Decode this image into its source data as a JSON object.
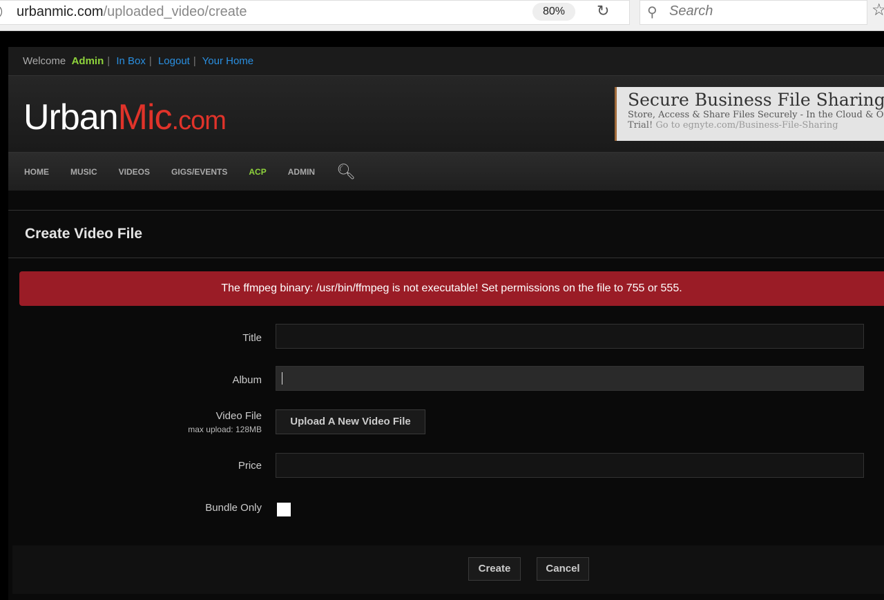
{
  "browser": {
    "url_domain": "urbanmic.com",
    "url_path": "/uploaded_video/create",
    "zoom": "80%",
    "search_placeholder": "Search"
  },
  "topbar": {
    "welcome": "Welcome",
    "user": "Admin",
    "links": [
      "In Box",
      "Logout",
      "Your Home"
    ]
  },
  "logo": {
    "part1": "Urban",
    "part2": "Mic",
    "part3": ".com"
  },
  "ad": {
    "title": "Secure Business File Sharing",
    "desc": "Store, Access & Share Files Securely - In the Cloud & On Premises",
    "trial": "Trial!",
    "link": "Go to egnyte.com/Business-File-Sharing"
  },
  "nav": [
    "HOME",
    "MUSIC",
    "VIDEOS",
    "GIGS/EVENTS",
    "ACP",
    "ADMIN"
  ],
  "page_title": "Create Video File",
  "alert": "The ffmpeg binary: /usr/bin/ffmpeg is not executable! Set permissions on the file to 755 or 555.",
  "form": {
    "title_label": "Title",
    "title_value": "",
    "album_label": "Album",
    "album_value": "",
    "video_label": "Video File",
    "video_sub": "max upload: 128MB",
    "upload_button": "Upload A New Video File",
    "price_label": "Price",
    "price_value": "",
    "bundle_label": "Bundle Only",
    "bundle_checked": false
  },
  "buttons": {
    "create": "Create",
    "cancel": "Cancel"
  },
  "colors": {
    "accent_green": "#8fd43c",
    "link_blue": "#2a8fe0",
    "alert_red": "#9a1c26",
    "logo_red": "#e0332a"
  }
}
